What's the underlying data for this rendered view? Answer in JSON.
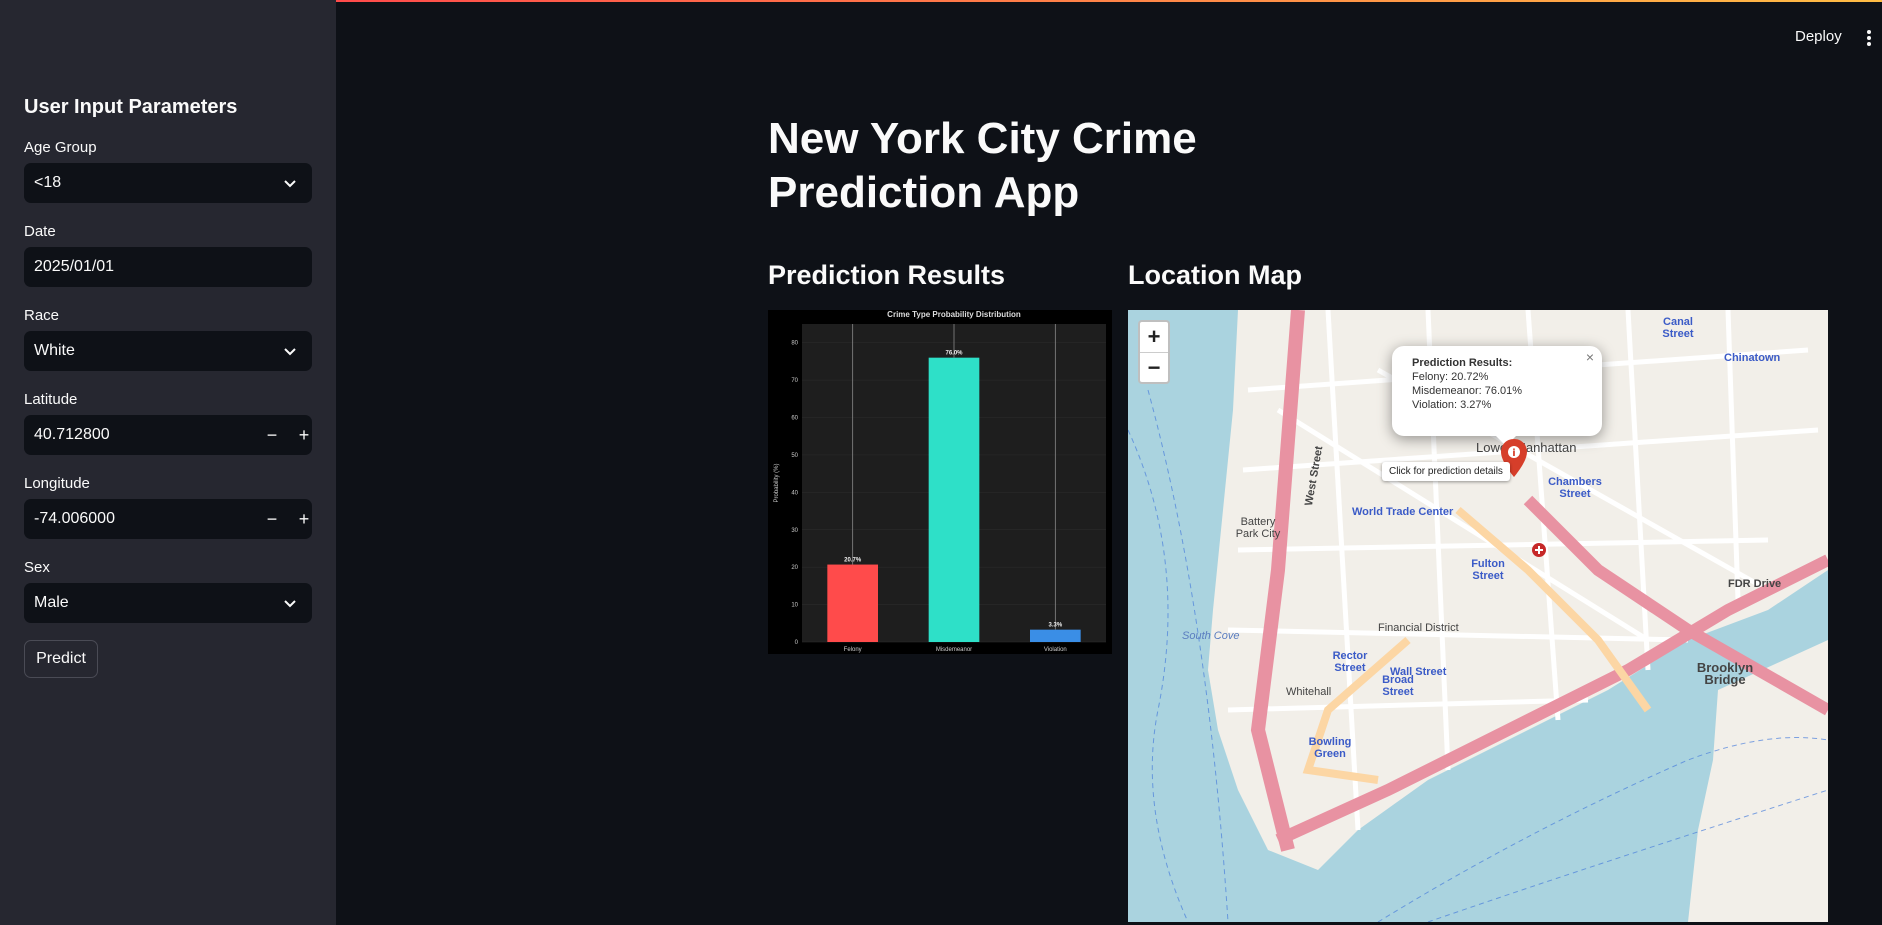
{
  "sidebar": {
    "title": "User Input Parameters",
    "age_group": {
      "label": "Age Group",
      "value": "<18"
    },
    "date": {
      "label": "Date",
      "value": "2025/01/01"
    },
    "race": {
      "label": "Race",
      "value": "White"
    },
    "latitude": {
      "label": "Latitude",
      "value": "40.712800",
      "minus": "−",
      "plus": "+"
    },
    "longitude": {
      "label": "Longitude",
      "value": "-74.006000",
      "minus": "−",
      "plus": "+"
    },
    "sex": {
      "label": "Sex",
      "value": "Male"
    },
    "predict_label": "Predict"
  },
  "header": {
    "deploy_label": "Deploy"
  },
  "main": {
    "title": "New York City Crime Prediction App",
    "prediction_heading": "Prediction Results",
    "map_heading": "Location Map"
  },
  "chart_data": {
    "type": "bar",
    "title": "Crime Type Probability Distribution",
    "xlabel": "",
    "ylabel": "Probability (%)",
    "categories": [
      "Felony",
      "Misdemeanor",
      "Violation"
    ],
    "values": [
      20.7,
      76.0,
      3.3
    ],
    "data_labels": [
      "20.7%",
      "76.0%",
      "3.3%"
    ],
    "colors": [
      "#ff4b4b",
      "#2ee0c8",
      "#3a8ee6"
    ],
    "ylim": [
      0,
      85
    ],
    "yticks": [
      0,
      10,
      20,
      30,
      40,
      50,
      60,
      70,
      80
    ],
    "grid": true
  },
  "map": {
    "zoom_in": "+",
    "zoom_out": "−",
    "popup": {
      "title": "Prediction Results:",
      "felony": "Felony: 20.72%",
      "misdemeanor": "Misdemeanor: 76.01%",
      "violation": "Violation: 3.27%",
      "close": "×"
    },
    "tooltip": "Click for prediction details",
    "labels": {
      "world_trade": "World Trade Center",
      "battery_park_city": "Battery Park City",
      "financial_district": "Financial District",
      "wall_street": "Wall Street",
      "brooklyn_bridge": "Brooklyn Bridge",
      "chambers_street": "Chambers Street",
      "fulton_street": "Fulton Street",
      "south_cove": "South Cove",
      "bowling_green": "Bowling Green",
      "chinatown": "Chinatown",
      "fdr_drive": "FDR Drive",
      "west_street": "West Street",
      "canal_street": "Canal Street",
      "whitehall": "Whitehall",
      "rector_street": "Rector Street",
      "broad_street": "Broad Street",
      "lower_manhattan": "Lower Manhattan"
    },
    "colors": {
      "water": "#aad3df",
      "land": "#f2efe9",
      "highway": "#e892a2",
      "road": "#ffffff"
    }
  }
}
